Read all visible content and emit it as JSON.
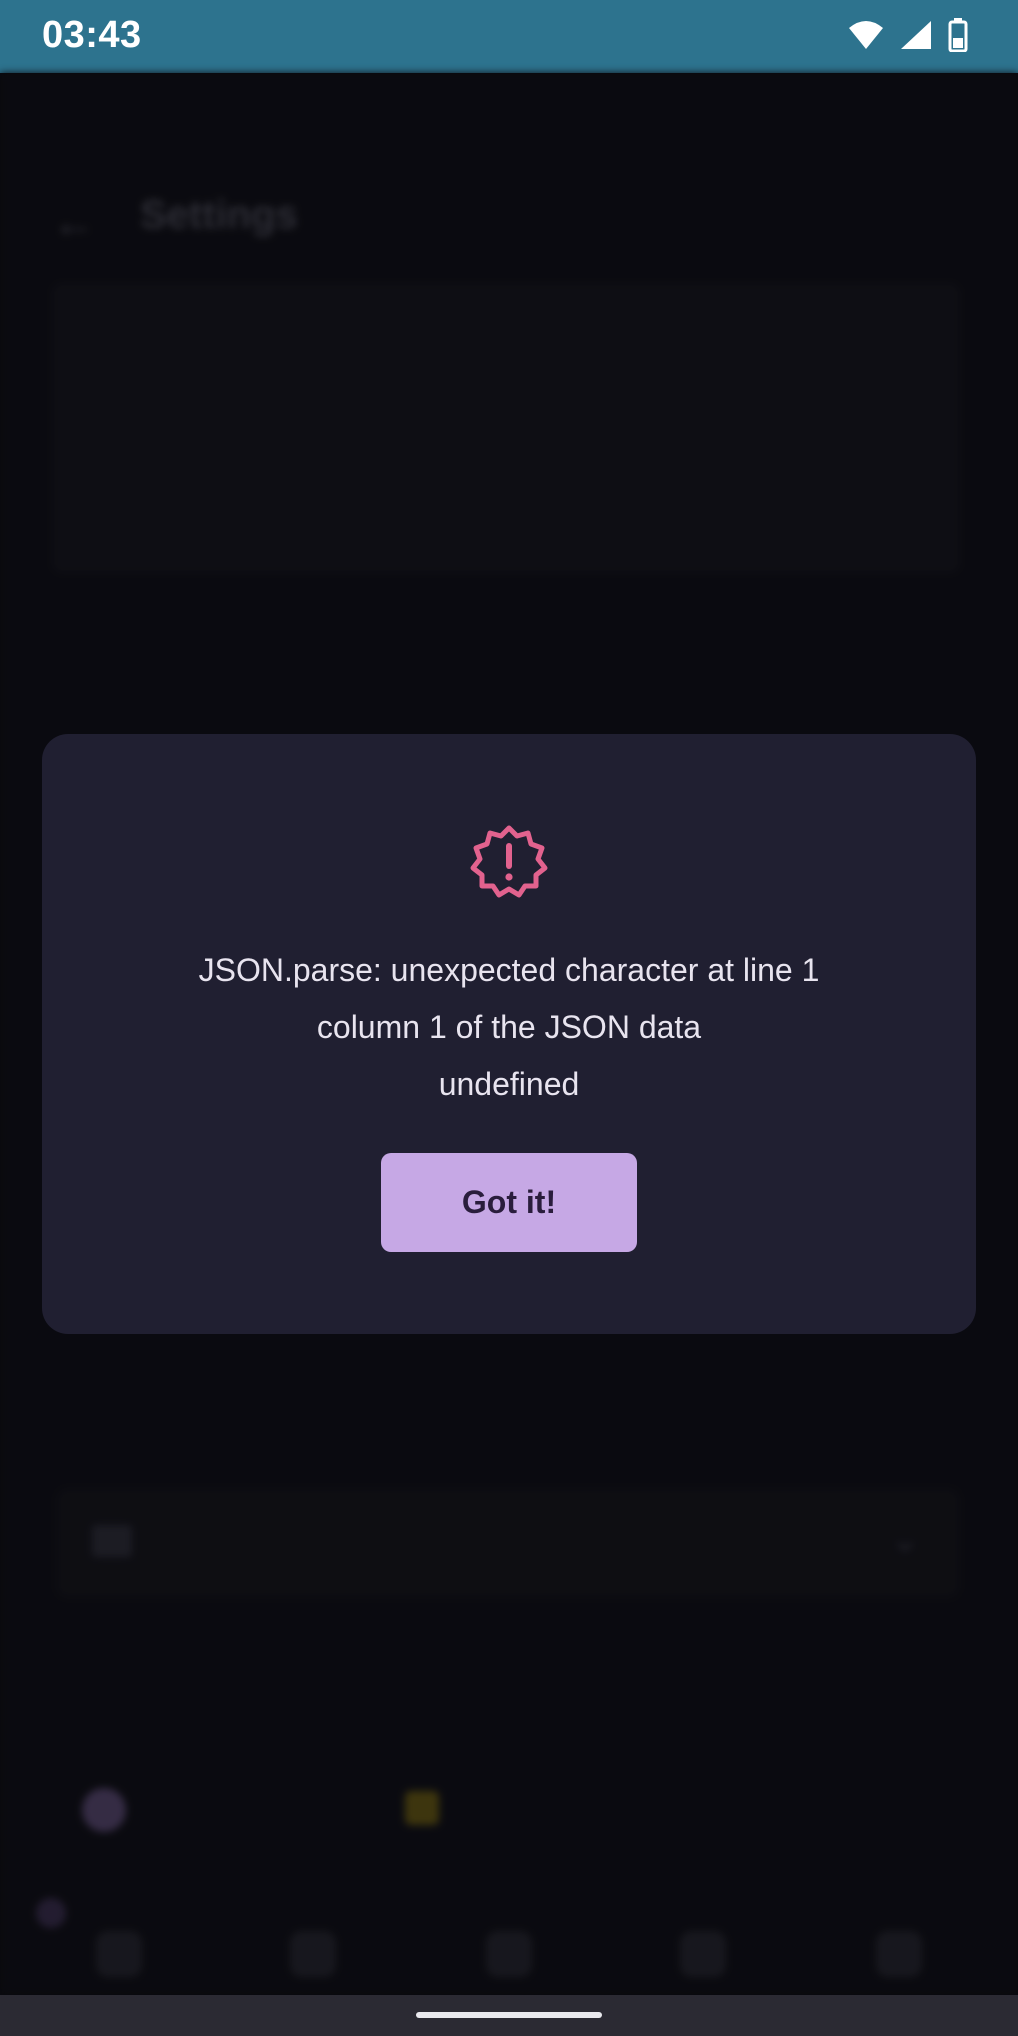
{
  "status_bar": {
    "time": "03:43",
    "icons": [
      "wifi-icon",
      "signal-icon",
      "battery-icon"
    ]
  },
  "background": {
    "back_icon": "arrow-left-icon",
    "title": "Settings",
    "collapse_icon": "info-card-icon",
    "collapse_chevron": "chevron-down-icon"
  },
  "dialog": {
    "icon": "alert-badge-icon",
    "message": "JSON.parse: unexpected character at line 1\ncolumn 1 of the JSON data\nundefined",
    "button_label": "Got it!"
  },
  "colors": {
    "status_bar_bg": "#2d738e",
    "dialog_bg": "#201f31",
    "alert_icon": "#e2628e",
    "button_bg": "#c6a8e5",
    "button_text": "#2a1d3c"
  }
}
